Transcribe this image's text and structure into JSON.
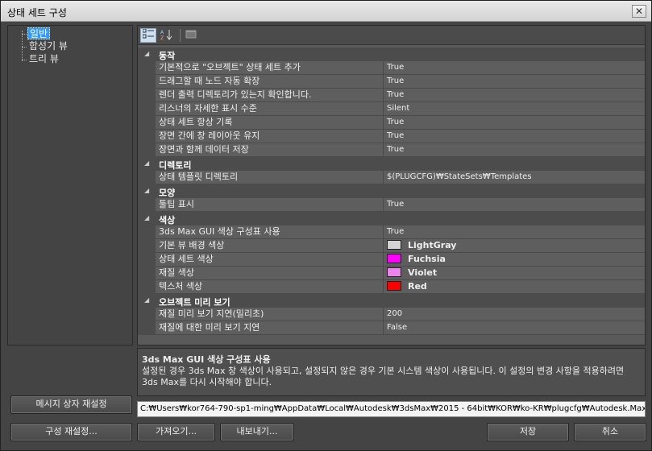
{
  "window": {
    "title": "상태 세트 구성",
    "close_label": "✕"
  },
  "tree": {
    "items": [
      {
        "label": "일반",
        "selected": true
      },
      {
        "label": "합성기 뷰",
        "selected": false
      },
      {
        "label": "트리 뷰",
        "selected": false
      }
    ]
  },
  "toolbar": {
    "categorized_icon": "categorized-icon",
    "alphabetical_icon": "alphabetical-icon",
    "pages_icon": "property-pages-icon"
  },
  "grid": {
    "categories": [
      {
        "label": "동작",
        "props": [
          {
            "name": "기본적으로 \"오브젝트\" 상태 세트 추가",
            "value": "True"
          },
          {
            "name": "드래그할 때 노드 자동 확장",
            "value": "True"
          },
          {
            "name": "렌더 출력 디렉토리가 있는지 확인합니다.",
            "value": "True"
          },
          {
            "name": "리스너의 자세한 표시 수준",
            "value": "Silent"
          },
          {
            "name": "상태 세트 항상 기록",
            "value": "True"
          },
          {
            "name": "장면 간에 창 레이아웃 유지",
            "value": "True"
          },
          {
            "name": "장면과 함께 데이터 저장",
            "value": "True"
          }
        ]
      },
      {
        "label": "디렉토리",
        "props": [
          {
            "name": "상태 템플릿 디렉토리",
            "value": "$(PLUGCFG)₩StateSets₩Templates"
          }
        ]
      },
      {
        "label": "모양",
        "props": [
          {
            "name": "툴팁 표시",
            "value": "True"
          }
        ]
      },
      {
        "label": "색상",
        "props": [
          {
            "name": "3ds Max GUI 색상 구성표 사용",
            "value": "True"
          },
          {
            "name": "기본 뷰 배경 색상",
            "value": "LightGray",
            "color": "#d3d3d3"
          },
          {
            "name": "상태 세트 색상",
            "value": "Fuchsia",
            "color": "#ff00ff"
          },
          {
            "name": "재질 색상",
            "value": "Violet",
            "color": "#ee82ee"
          },
          {
            "name": "텍스처 색상",
            "value": "Red",
            "color": "#ff0000"
          }
        ]
      },
      {
        "label": "오브젝트 미리 보기",
        "props": [
          {
            "name": "재질 미리 보기 지연(밀리초)",
            "value": "200"
          },
          {
            "name": "재질에 대한 미리 보기 지연",
            "value": "False"
          }
        ]
      }
    ]
  },
  "description": {
    "title": "3ds Max GUI 색상 구성표 사용",
    "body": "설정된 경우 3ds Max 창 색상이 사용되고, 설정되지 않은 경우 기본 시스템 색상이 사용됩니다. 이 설정의 변경 사항을 적용하려면 3ds Max를 다시 시작해야 합니다."
  },
  "path": "C:₩Users₩kor764-790-sp1-ming₩AppData₩Local₩Autodesk₩3dsMax₩2015 - 64bit₩KOR₩ko-KR₩plugcfg₩Autodesk.Max.",
  "buttons": {
    "reset_messagebox": "메시지 상자 재설정",
    "reset_config": "구성 재설정...",
    "import": "가져오기...",
    "export": "내보내기...",
    "save": "저장",
    "cancel": "취소"
  }
}
